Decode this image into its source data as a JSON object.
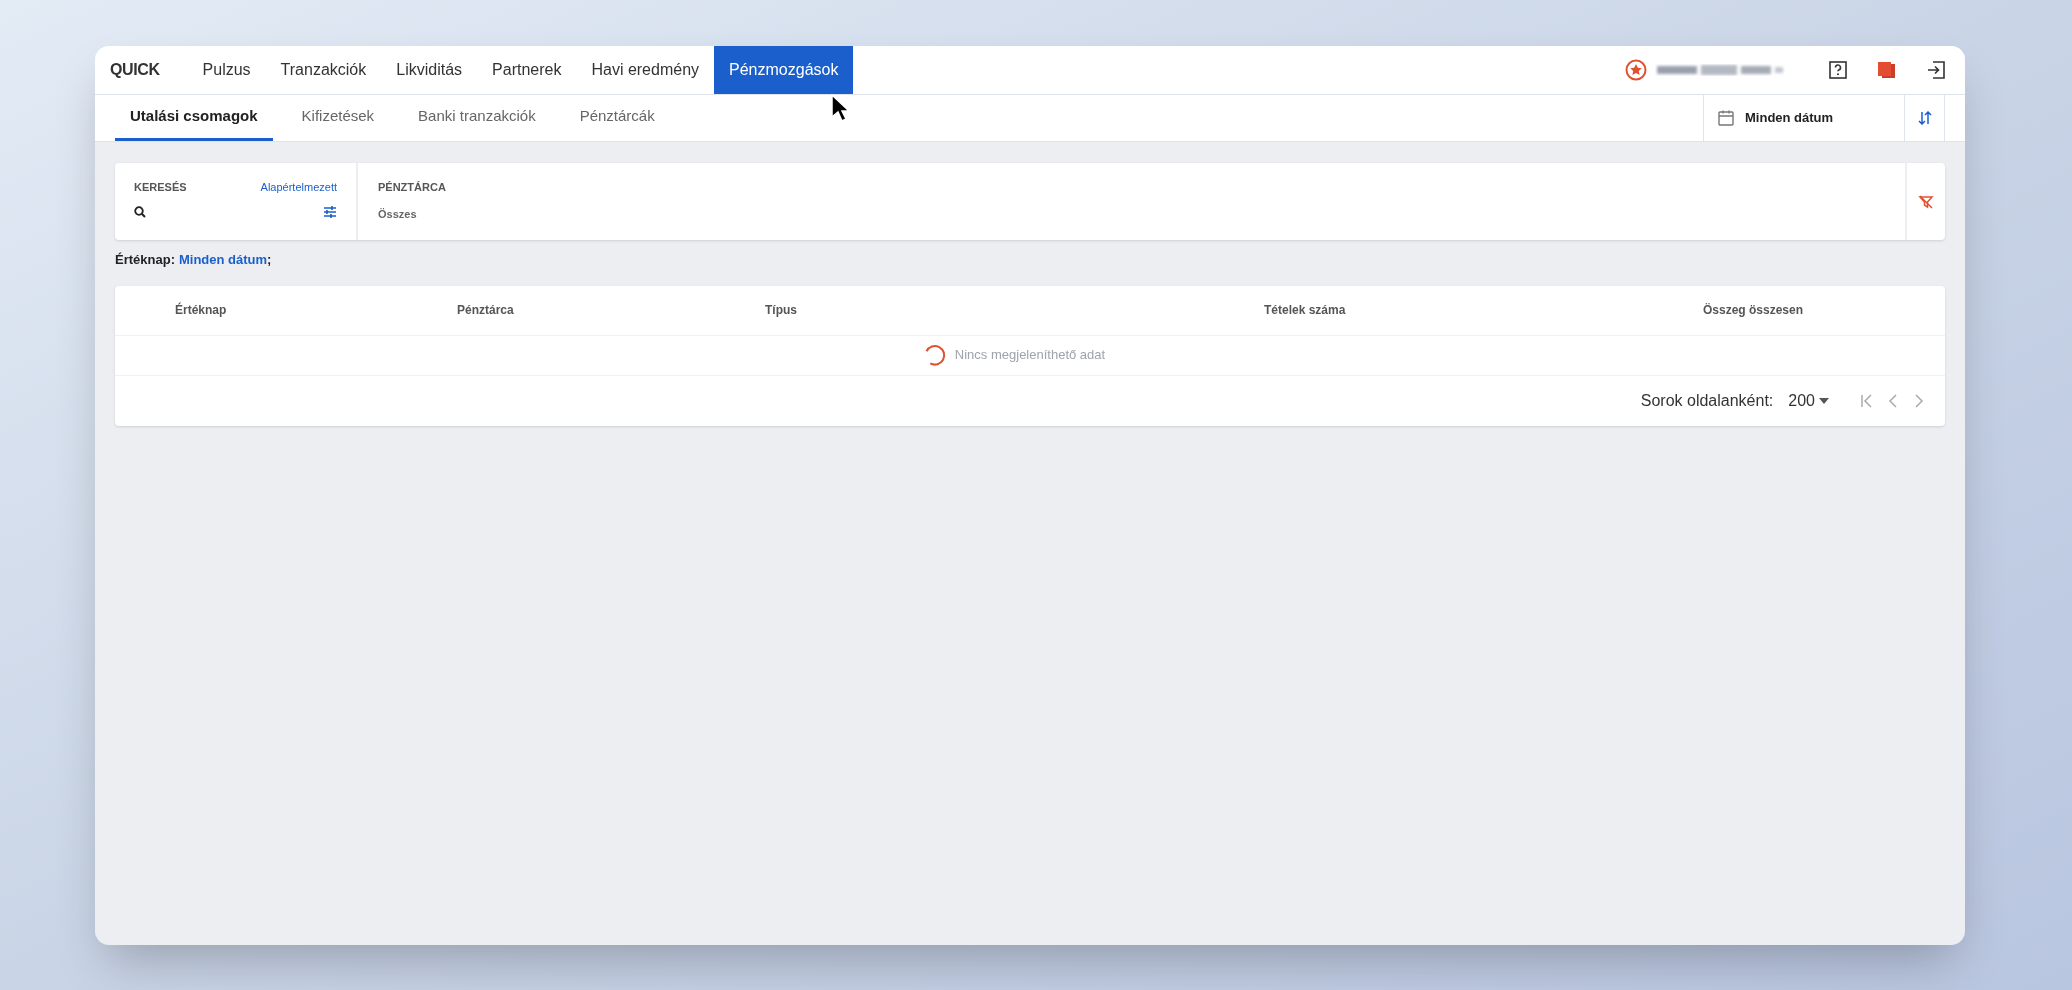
{
  "app": {
    "logo": "QUICK"
  },
  "nav": [
    {
      "label": "Pulzus",
      "selected": false
    },
    {
      "label": "Tranzakciók",
      "selected": false
    },
    {
      "label": "Likviditás",
      "selected": false
    },
    {
      "label": "Partnerek",
      "selected": false
    },
    {
      "label": "Havi eredmény",
      "selected": false
    },
    {
      "label": "Pénzmozgások",
      "selected": true
    }
  ],
  "subtabs": [
    {
      "label": "Utalási csomagok",
      "selected": true
    },
    {
      "label": "Kifizetések",
      "selected": false
    },
    {
      "label": "Banki tranzakciók",
      "selected": false
    },
    {
      "label": "Pénztárcák",
      "selected": false
    }
  ],
  "date_filter": {
    "value": "Minden dátum"
  },
  "filters": [
    {
      "kind": "search",
      "label": "KERESÉS",
      "link": "Alapértelmezett"
    },
    {
      "kind": "select",
      "label": "PÉNZTÁRCA",
      "value": "Összes"
    }
  ],
  "active_filters": {
    "label": "Értéknap:",
    "value": "Minden dátum",
    "suffix": ";"
  },
  "table": {
    "columns": [
      "Értéknap",
      "Pénztárca",
      "Típus",
      "Tételek száma",
      "Összeg összesen"
    ],
    "empty_message": "Nincs megjeleníthető adat",
    "loading": true
  },
  "pagination": {
    "label": "Sorok oldalanként:",
    "page_size": "200"
  }
}
